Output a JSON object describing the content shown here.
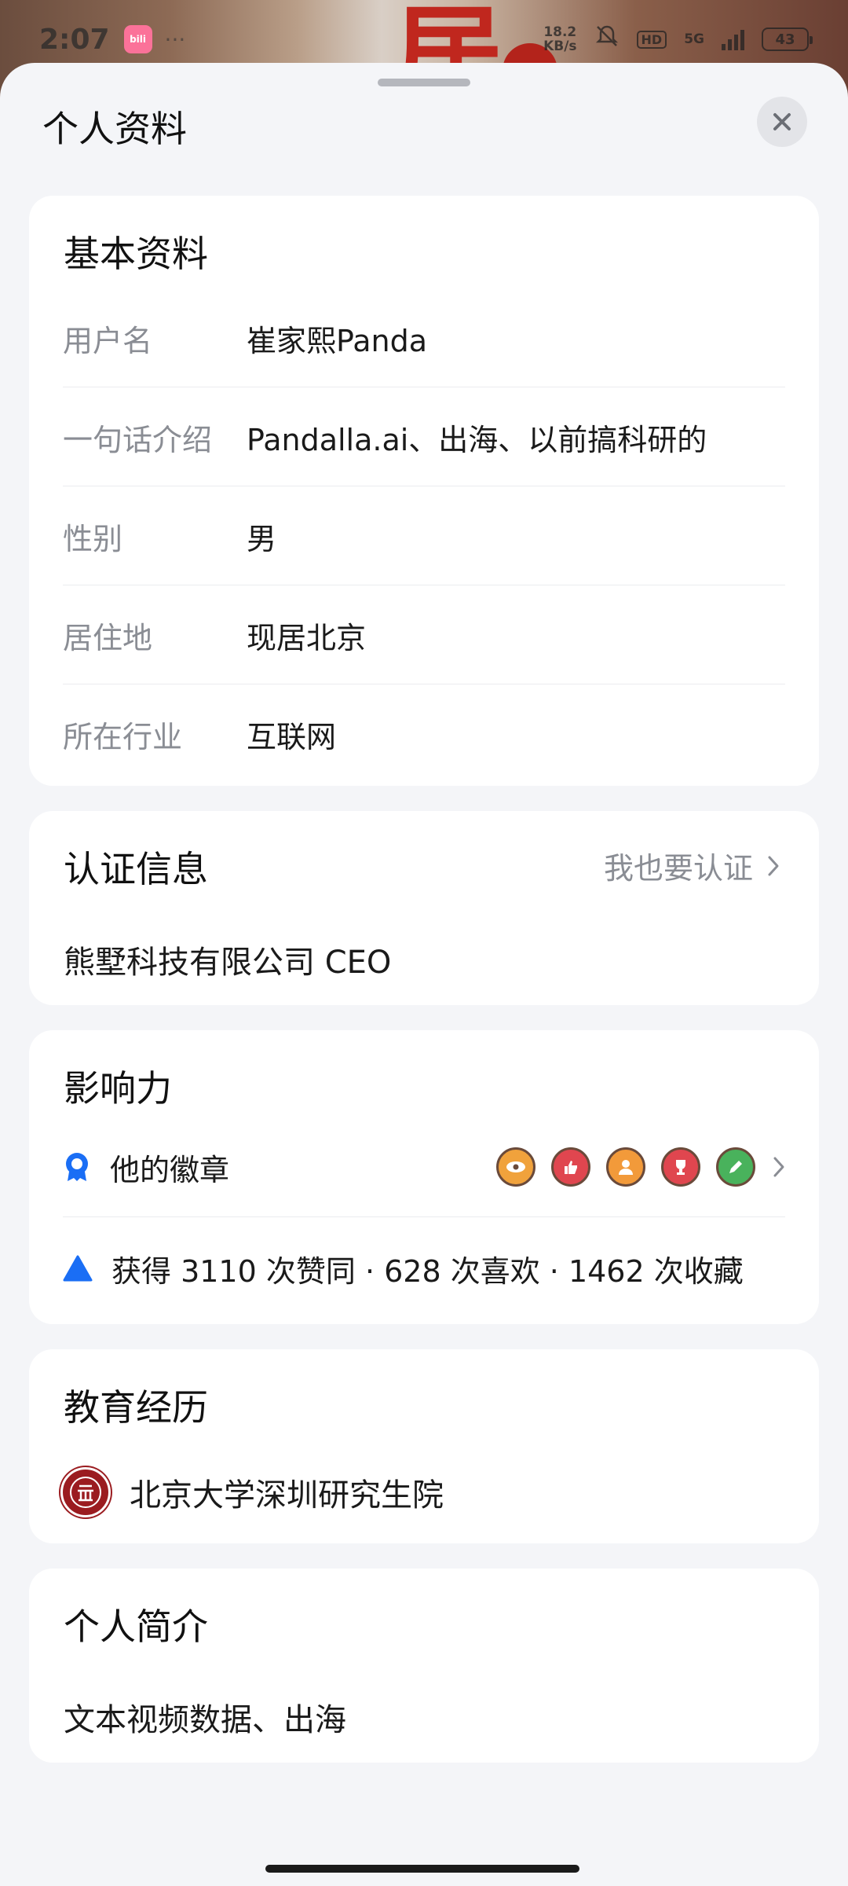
{
  "status_bar": {
    "time": "2:07",
    "app_badge": "bili",
    "dots": "···",
    "speed_value": "18.2",
    "speed_unit": "KB/s",
    "hd": "HD",
    "network": "5G",
    "battery": "43"
  },
  "sheet": {
    "title": "个人资料",
    "close_icon": "close-icon"
  },
  "basic_info": {
    "title": "基本资料",
    "rows": [
      {
        "label": "用户名",
        "value": "崔家熙Panda"
      },
      {
        "label": "一句话介绍",
        "value": "Pandalla.ai、出海、以前搞科研的"
      },
      {
        "label": "性别",
        "value": "男"
      },
      {
        "label": "居住地",
        "value": "现居北京"
      },
      {
        "label": "所在行业",
        "value": "互联网"
      }
    ]
  },
  "verification": {
    "title": "认证信息",
    "link_label": "我也要认证",
    "detail": "熊墅科技有限公司 CEO"
  },
  "influence": {
    "title": "影响力",
    "badges_label": "他的徽章",
    "badges": [
      {
        "icon": "eye-badge-icon",
        "color": "#f0a23c"
      },
      {
        "icon": "thumbs-up-badge-icon",
        "color": "#e0464f"
      },
      {
        "icon": "person-badge-icon",
        "color": "#f29a3a"
      },
      {
        "icon": "trophy-badge-icon",
        "color": "#e0464f"
      },
      {
        "icon": "pencil-badge-icon",
        "color": "#49b25c"
      }
    ],
    "stats": "获得 3110 次赞同 · 628 次喜欢 · 1462 次收藏"
  },
  "education": {
    "title": "教育经历",
    "school": "北京大学深圳研究生院"
  },
  "bio": {
    "title": "个人简介",
    "text": "文本视频数据、出海"
  },
  "colors": {
    "accent_blue": "#1a6ef5",
    "sheet_bg": "#f4f5f8",
    "muted": "#8a8d94"
  }
}
